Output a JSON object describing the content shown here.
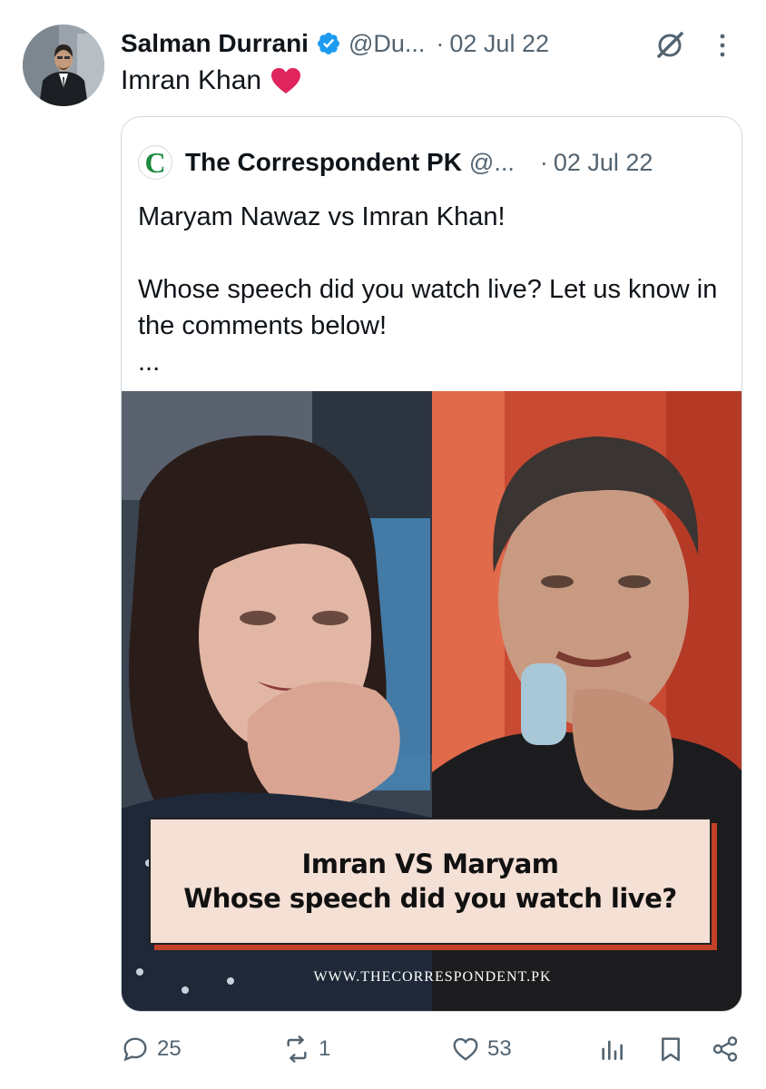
{
  "post": {
    "author_name": "Salman Durrani",
    "handle": "@Du...",
    "separator": "·",
    "date": "02 Jul 22",
    "text": "Imran Khan",
    "emoji": "heart-emoji"
  },
  "quote": {
    "avatar_letter": "C",
    "author_name": "The Correspondent PK",
    "handle": "@...",
    "separator": "·",
    "date": "02 Jul 22",
    "line1": "Maryam Nawaz vs Imran Khan!",
    "line2": "Whose speech did you watch live? Let us know in the comments below!",
    "more": "...",
    "media": {
      "caption_line1": "Imran VS Maryam",
      "caption_line2": "Whose speech did you watch live?",
      "watermark": "WWW.THECORRESPONDENT.PK"
    }
  },
  "actions": {
    "replies": "25",
    "reposts": "1",
    "likes": "53"
  },
  "colors": {
    "verified": "#1d9bf0",
    "secondary_text": "#536471",
    "heart": "#e0245e",
    "caption_shadow": "#c44128"
  },
  "icons": [
    "verified-badge-icon",
    "grok-icon",
    "more-icon",
    "reply-icon",
    "repost-icon",
    "like-icon",
    "views-icon",
    "bookmark-icon",
    "share-icon"
  ]
}
